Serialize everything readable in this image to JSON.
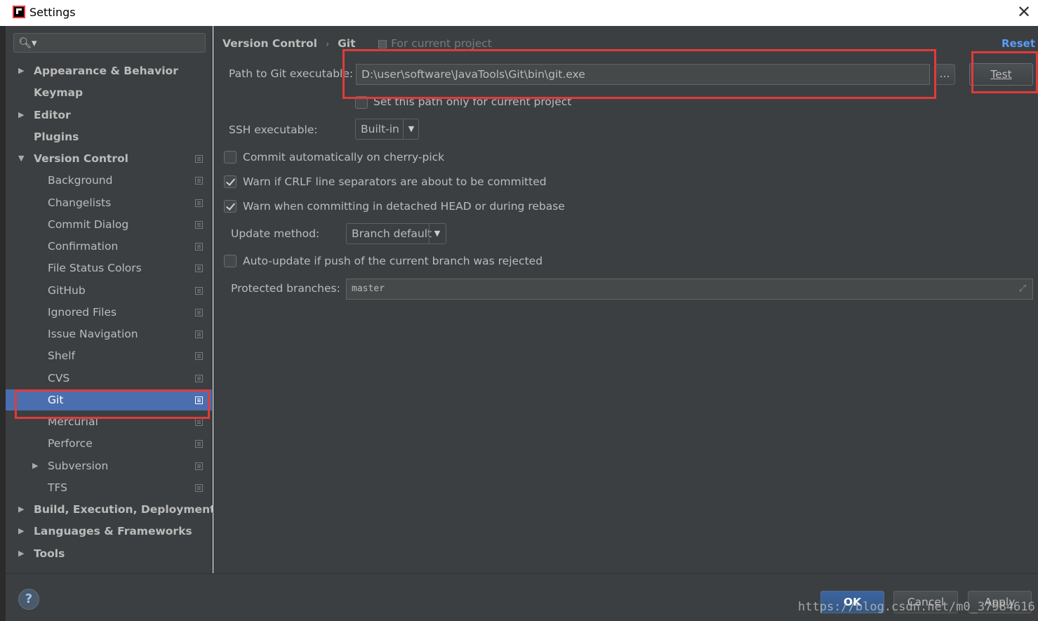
{
  "window": {
    "title": "Settings",
    "close_glyph": "✕"
  },
  "sidebar": {
    "search_placeholder": "",
    "items": [
      {
        "label": "Appearance & Behavior",
        "arrow": "▶"
      },
      {
        "label": "Keymap"
      },
      {
        "label": "Editor",
        "arrow": "▶"
      },
      {
        "label": "Plugins"
      },
      {
        "label": "Version Control",
        "arrow": "▼"
      },
      {
        "label": "Background"
      },
      {
        "label": "Changelists"
      },
      {
        "label": "Commit Dialog"
      },
      {
        "label": "Confirmation"
      },
      {
        "label": "File Status Colors"
      },
      {
        "label": "GitHub"
      },
      {
        "label": "Ignored Files"
      },
      {
        "label": "Issue Navigation"
      },
      {
        "label": "Shelf"
      },
      {
        "label": "CVS"
      },
      {
        "label": "Git"
      },
      {
        "label": "Mercurial"
      },
      {
        "label": "Perforce"
      },
      {
        "label": "Subversion",
        "arrow": "▶"
      },
      {
        "label": "TFS"
      },
      {
        "label": "Build, Execution, Deployment",
        "arrow": "▶"
      },
      {
        "label": "Languages & Frameworks",
        "arrow": "▶"
      },
      {
        "label": "Tools",
        "arrow": "▶"
      }
    ],
    "selected": "Git"
  },
  "header": {
    "crumb_parent": "Version Control",
    "crumb_separator": "›",
    "crumb_current": "Git",
    "scope": "For current project",
    "reset": "Reset"
  },
  "git": {
    "path_label": "Path to Git executable:",
    "path_value": "D:\\user\\software\\JavaTools\\Git\\bin\\git.exe",
    "browse_label": "...",
    "test_label": "Test",
    "project_only_label": "Set this path only for current project",
    "project_only_checked": false,
    "ssh_label": "SSH executable:",
    "ssh_value": "Built-in",
    "cherry_pick_label": "Commit automatically on cherry-pick",
    "cherry_pick_checked": false,
    "crlf_label": "Warn if CRLF line separators are about to be committed",
    "crlf_checked": true,
    "detached_label": "Warn when committing in detached HEAD or during rebase",
    "detached_checked": true,
    "update_label": "Update method:",
    "update_value": "Branch default",
    "auto_update_label": "Auto-update if push of the current branch was rejected",
    "auto_update_checked": false,
    "protected_label": "Protected branches:",
    "protected_value": "master"
  },
  "footer": {
    "help": "?",
    "ok": "OK",
    "cancel": "Cancel",
    "apply": "Apply"
  },
  "watermark": "https://blog.csdn.net/m0_37984616",
  "colors": {
    "background": "#3c3f41",
    "selection": "#4b6eaf",
    "link": "#589df6",
    "annotation": "#e03b3b"
  }
}
